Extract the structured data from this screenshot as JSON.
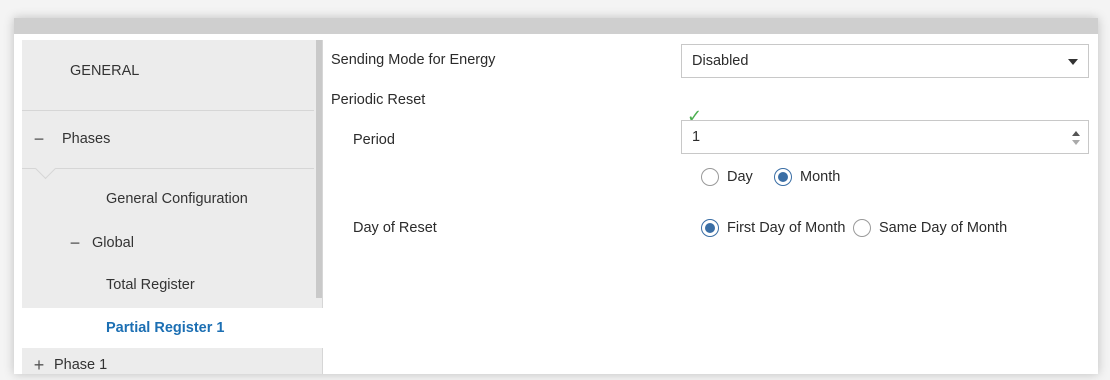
{
  "sidebar": {
    "general": "GENERAL",
    "phases": {
      "symbol": "−",
      "label": "Phases"
    },
    "general_configuration": "General Configuration",
    "global": {
      "symbol": "−",
      "label": "Global"
    },
    "total_register": "Total Register",
    "partial_register_1": "Partial Register 1",
    "phase_1": {
      "symbol": "+",
      "label": "Phase 1"
    }
  },
  "main": {
    "sending_mode": {
      "label": "Sending Mode for Energy",
      "value": "Disabled"
    },
    "periodic_reset": {
      "label": "Periodic Reset",
      "checked": true
    },
    "period": {
      "label": "Period",
      "value": "1"
    },
    "period_unit": {
      "options": [
        "Day",
        "Month"
      ],
      "selected": "Month"
    },
    "day_of_reset": {
      "label": "Day of Reset",
      "options": [
        "First Day of Month",
        "Same Day of Month"
      ],
      "selected": "First Day of Month"
    }
  },
  "colors": {
    "accent": "#1c6fb3",
    "check": "#4caf50",
    "radio": "#3a6ea5"
  }
}
